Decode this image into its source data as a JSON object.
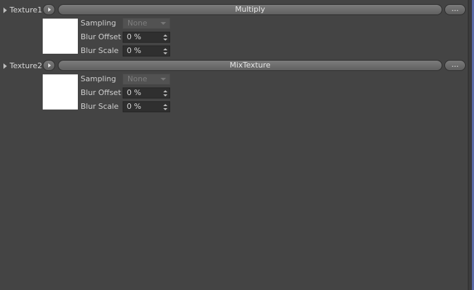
{
  "slots": [
    {
      "label": "Texture1",
      "shader": "Multiply",
      "more_label": "...",
      "props": [
        {
          "label": "Sampling",
          "value": "None"
        },
        {
          "label": "Blur Offset",
          "value": "0 %"
        },
        {
          "label": "Blur Scale",
          "value": "0 %"
        }
      ]
    },
    {
      "label": "Texture2",
      "shader": "MixTexture",
      "more_label": "...",
      "props": [
        {
          "label": "Sampling",
          "value": "None"
        },
        {
          "label": "Blur Offset",
          "value": "0 %"
        },
        {
          "label": "Blur Scale",
          "value": "0 %"
        }
      ]
    }
  ],
  "colors": {
    "background": "#444444",
    "preview": "#ffffff",
    "field_bg": "#2f2f2f",
    "accent_edge": "#5a6aa8"
  }
}
